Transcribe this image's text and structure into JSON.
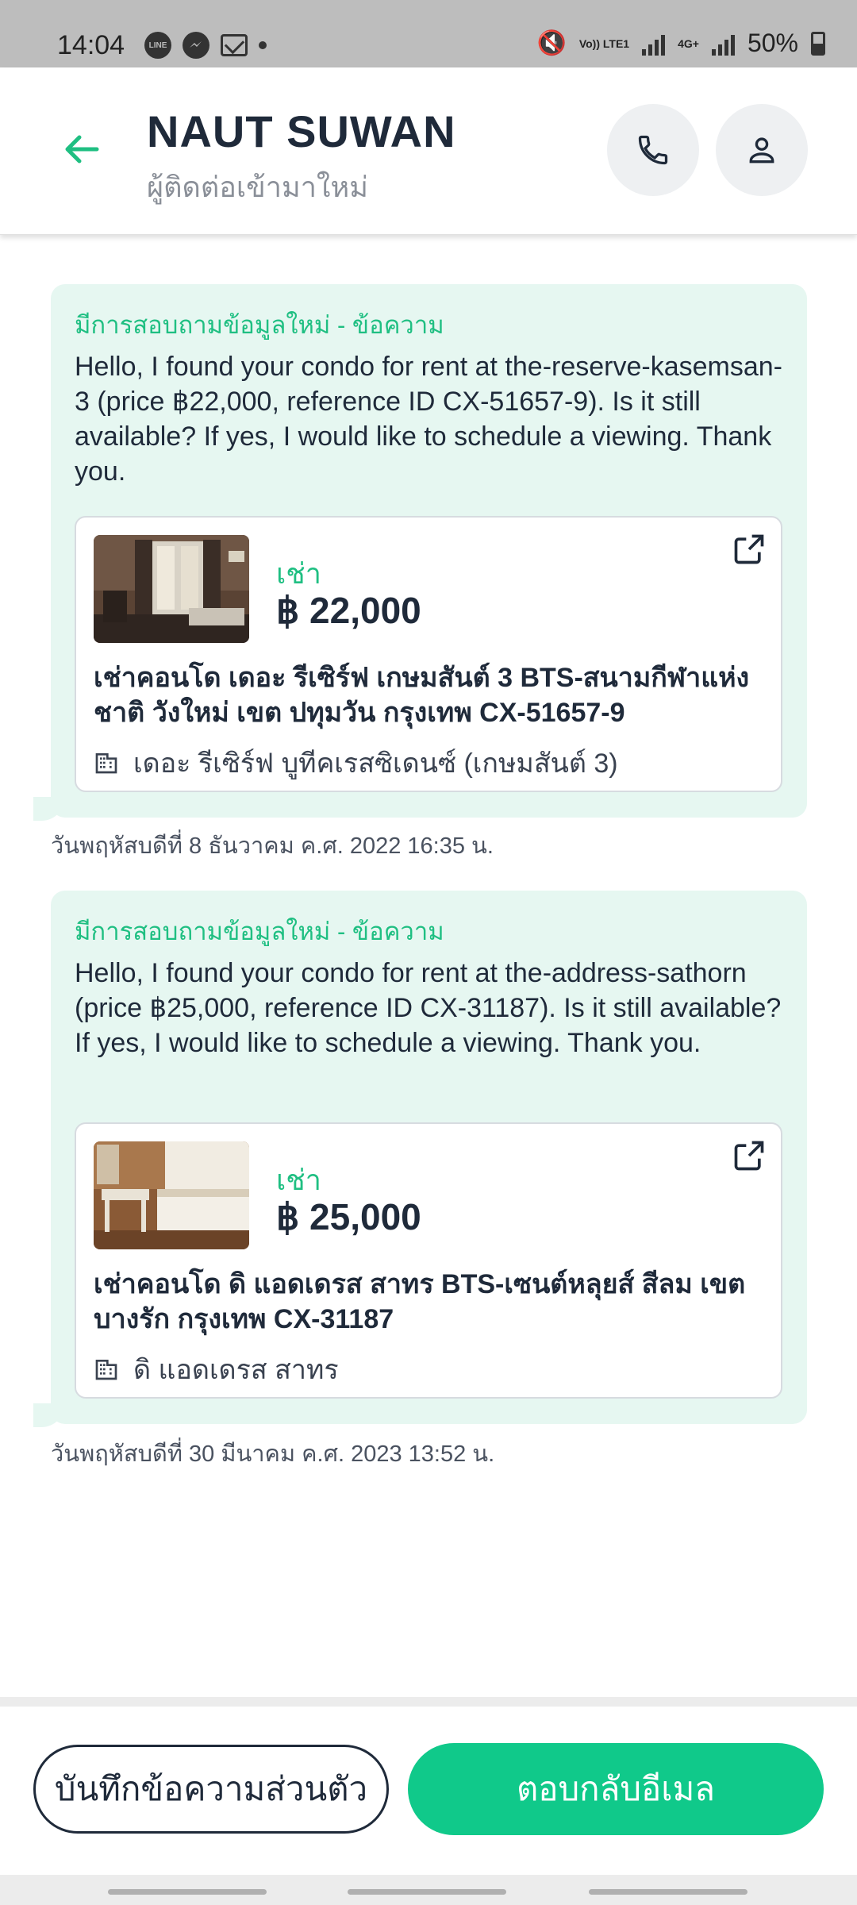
{
  "status_bar": {
    "time": "14:04",
    "network_1": "Vo)) LTE1",
    "network_2": "4G+",
    "battery": "50%",
    "app_icons": [
      "line-icon",
      "messenger-icon",
      "gmail-icon"
    ]
  },
  "header": {
    "name": "NAUT SUWAN",
    "subtitle": "ผู้ติดต่อเข้ามาใหม่"
  },
  "messages": [
    {
      "label": "มีการสอบถามข้อมูลใหม่ - ข้อความ",
      "text": "Hello, I found your condo for rent at the-reserve-kasemsan-3 (price ฿22,000, reference ID CX-51657-9). Is it still available? If yes, I would like to schedule a viewing. Thank you.",
      "listing": {
        "type": "เช่า",
        "price": "฿ 22,000",
        "title": "เช่าคอนโด  เดอะ รีเซิร์ฟ เกษมสันต์ 3 BTS-สนามกีฬาแห่งชาติ วังใหม่ เขต ปทุมวัน กรุงเทพ CX-51657-9",
        "project": "เดอะ รีเซิร์ฟ บูทีคเรสซิเดนซ์ (เกษมสันต์ 3)"
      },
      "timestamp": "วันพฤหัสบดีที่ 8 ธันวาคม ค.ศ. 2022 16:35 น."
    },
    {
      "label": "มีการสอบถามข้อมูลใหม่ - ข้อความ",
      "text": "Hello, I found your condo for rent at the-address-sathorn (price ฿25,000, reference ID CX-31187). Is it still available? If yes, I would like to schedule a viewing. Thank you.",
      "listing": {
        "type": "เช่า",
        "price": "฿ 25,000",
        "title": "เช่าคอนโด  ดิ แอดเดรส สาทร BTS-เซนต์หลุยส์ สีลม เขต บางรัก กรุงเทพ CX-31187",
        "project": "ดิ แอดเดรส สาทร"
      },
      "timestamp": "วันพฤหัสบดีที่ 30 มีนาคม ค.ศ. 2023 13:52 น."
    }
  ],
  "actions": {
    "note_label": "บันทึกข้อความส่วนตัว",
    "reply_label": "ตอบกลับอีเมล"
  },
  "colors": {
    "accent": "#10c98a",
    "bubble": "#e6f7f1",
    "text": "#1f2a3a"
  }
}
